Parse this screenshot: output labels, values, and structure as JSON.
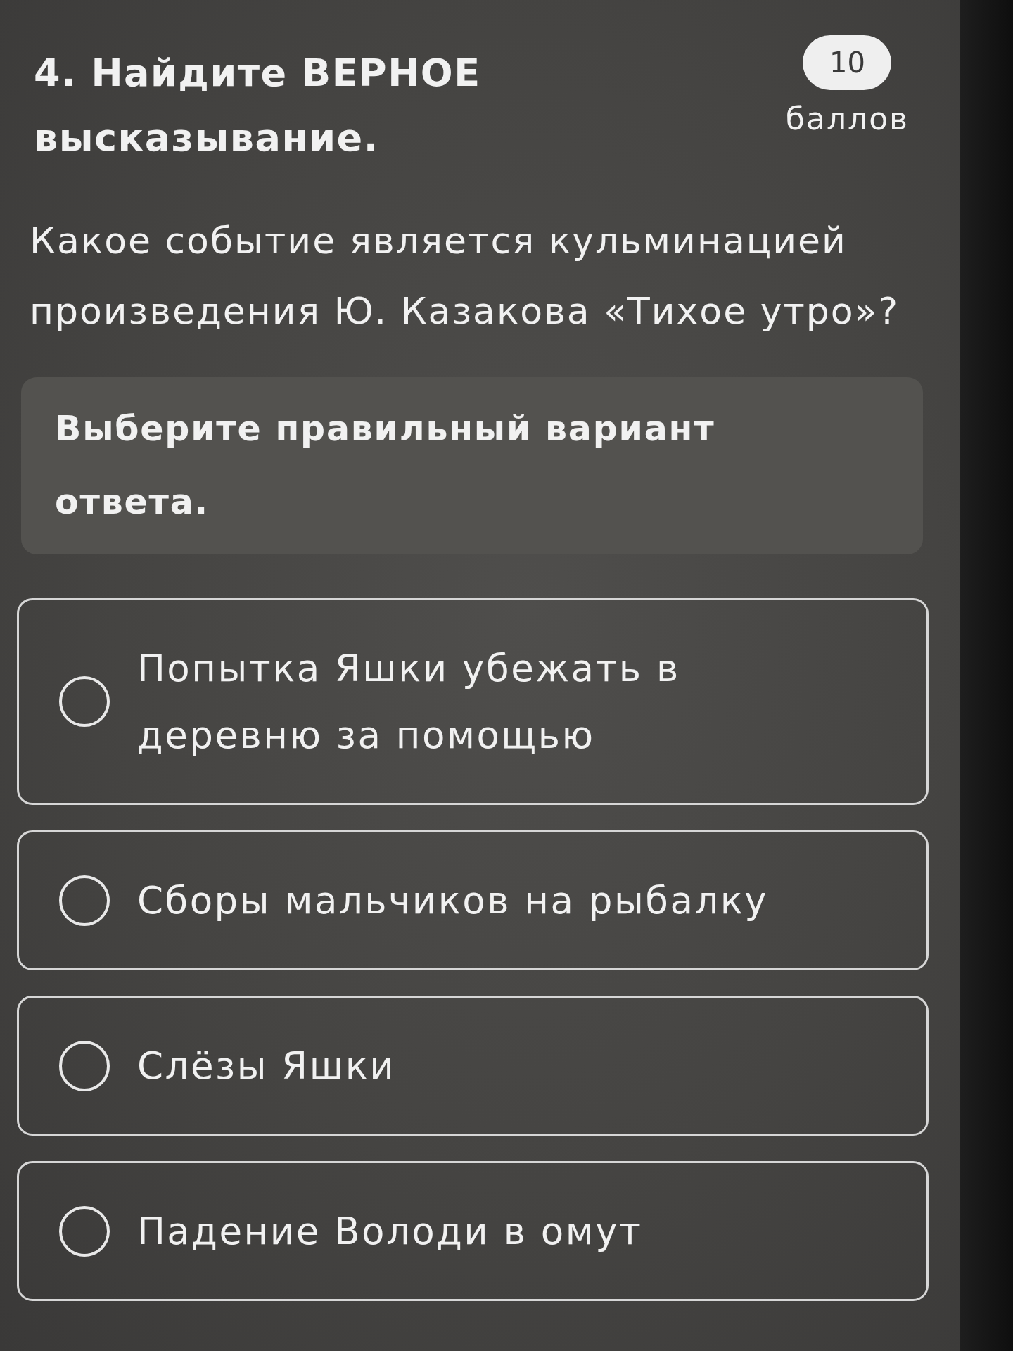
{
  "question": {
    "title": "4. Найдите ВЕРНОЕ высказывание.",
    "points": {
      "value": "10",
      "unit": "баллов"
    },
    "text": "Какое событие является кульминацией произведения Ю. Казакова «Тихое утро»?"
  },
  "instruction": "Выберите правильный вариант ответа.",
  "options": [
    {
      "label": "Попытка Яшки убежать в деревню за помощью",
      "selected": false
    },
    {
      "label": "Сборы мальчиков на рыбалку",
      "selected": false
    },
    {
      "label": "Слёзы Яшки",
      "selected": false
    },
    {
      "label": "Падение Володи в омут",
      "selected": false
    }
  ]
}
